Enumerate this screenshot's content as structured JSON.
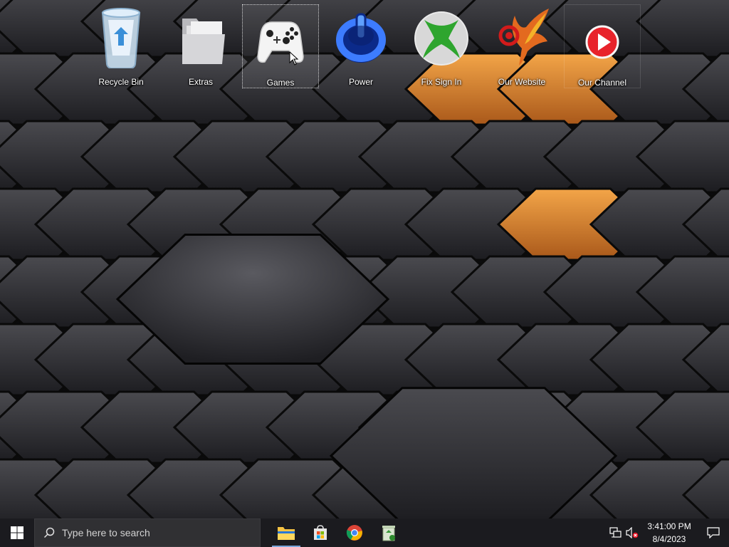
{
  "desktop": {
    "icons": [
      {
        "label": "Recycle Bin",
        "icon": "recycle-bin-icon"
      },
      {
        "label": "Extras",
        "icon": "folder-icon"
      },
      {
        "label": "Games",
        "icon": "game-controller-icon",
        "selected": true
      },
      {
        "label": "Power",
        "icon": "power-icon"
      },
      {
        "label": "Fix Sign In",
        "icon": "xbox-icon"
      },
      {
        "label": "Our Website",
        "icon": "phoenix-logo-icon"
      },
      {
        "label": "Our Channel",
        "icon": "play-button-icon"
      }
    ]
  },
  "taskbar": {
    "search_placeholder": "Type here to search",
    "apps": [
      "file-explorer-icon",
      "microsoft-store-icon",
      "chrome-icon",
      "recycle-app-icon"
    ],
    "tray_icons": [
      "network-icon",
      "speaker-muted-icon"
    ],
    "time": "3:41:00 PM",
    "date": "8/4/2023"
  },
  "colors": {
    "taskbar_bg": "#1b1b1f",
    "search_bg": "#303033",
    "accent_orange": "#e8922a",
    "active_indicator": "#7aa6d9"
  }
}
